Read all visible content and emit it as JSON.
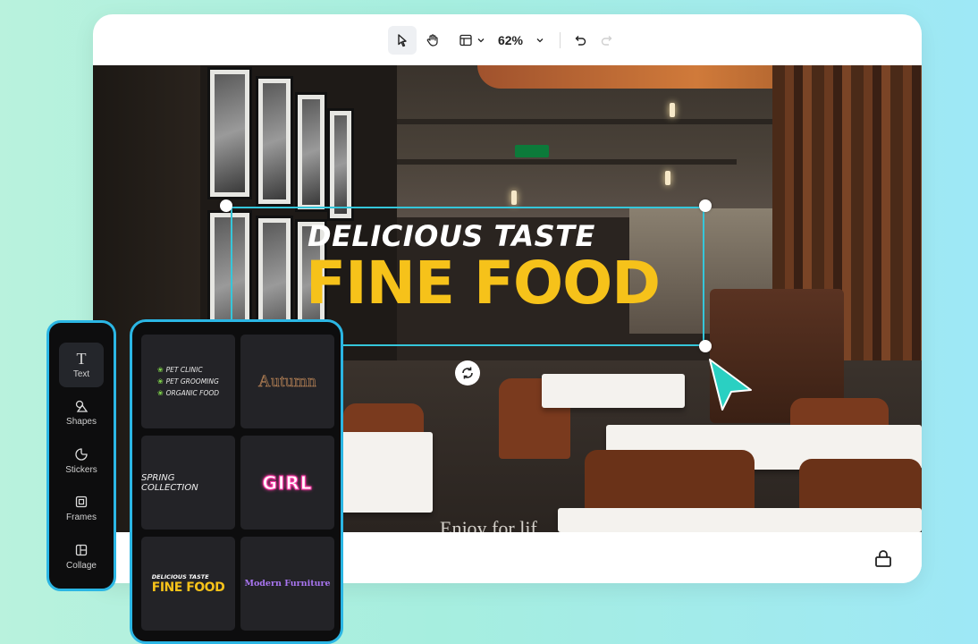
{
  "toolbar": {
    "select_tool": "select",
    "hand_tool": "pan",
    "layout_tool": "layout",
    "zoom_level": "62%",
    "undo": "undo",
    "redo": "redo"
  },
  "canvas": {
    "tagline": "DELICIOUS TASTE",
    "headline": "FINE FOOD",
    "partial_caption": "Enjoy for lif",
    "icons": {
      "rotate": "rotate-icon",
      "pointer": "cursor-pointer-icon",
      "export": "export-icon"
    }
  },
  "rail": {
    "items": [
      {
        "icon": "T",
        "label": "Text",
        "selected": true
      },
      {
        "icon": "shapes-icon",
        "label": "Shapes"
      },
      {
        "icon": "stickers-icon",
        "label": "Stickers"
      },
      {
        "icon": "frames-icon",
        "label": "Frames"
      },
      {
        "icon": "collage-icon",
        "label": "Collage"
      }
    ]
  },
  "templates": {
    "pet": [
      "PET CLINIC",
      "PET GROOMING",
      "ORGANIC FOOD"
    ],
    "autumn": "Autumn",
    "spring": "SPRING COLLECTION",
    "girl": "GIRL",
    "fine_food_tagline": "DELICIOUS TASTE",
    "fine_food_headline": "FINE FOOD",
    "modern": "Modern Furniture"
  },
  "colors": {
    "accent_border": "#2bb6e4",
    "selection": "#35c6da",
    "headline_yellow": "#f6c21a",
    "pointer_teal": "#2ad0c2",
    "panel_bg": "#0d0d0e"
  }
}
